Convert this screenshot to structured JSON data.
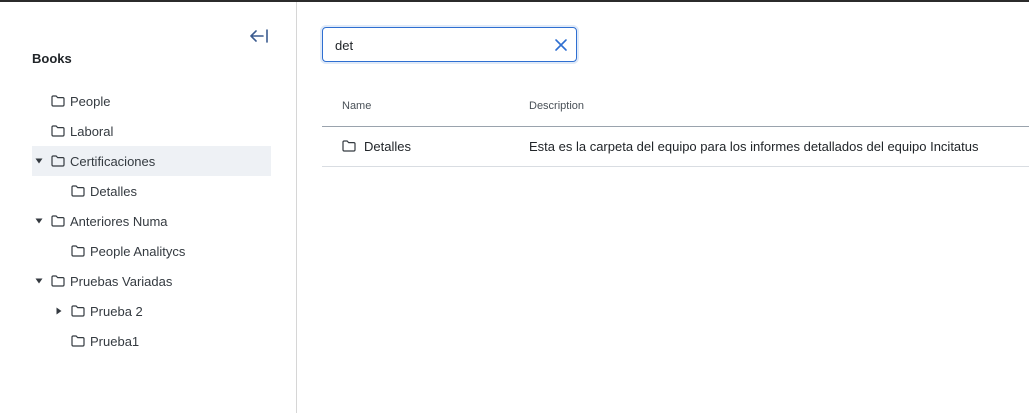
{
  "sidebar": {
    "title": "Books",
    "collapse_icon": "collapse-left-icon",
    "items": [
      {
        "label": "People",
        "caret": "none",
        "depth": 0,
        "selected": false
      },
      {
        "label": "Laboral",
        "caret": "none",
        "depth": 0,
        "selected": false
      },
      {
        "label": "Certificaciones",
        "caret": "down",
        "depth": 0,
        "selected": true
      },
      {
        "label": "Detalles",
        "caret": "none",
        "depth": 1,
        "selected": false
      },
      {
        "label": "Anteriores Numa",
        "caret": "down",
        "depth": 0,
        "selected": false
      },
      {
        "label": "People Analitycs",
        "caret": "none",
        "depth": 1,
        "selected": false
      },
      {
        "label": "Pruebas Variadas",
        "caret": "down",
        "depth": 0,
        "selected": false
      },
      {
        "label": "Prueba 2",
        "caret": "right",
        "depth": 1,
        "selected": false
      },
      {
        "label": "Prueba1",
        "caret": "none",
        "depth": 1,
        "selected": false
      }
    ]
  },
  "search": {
    "value": "det",
    "clear_icon": "close-icon"
  },
  "table": {
    "headers": {
      "name": "Name",
      "description": "Description"
    },
    "rows": [
      {
        "name": "Detalles",
        "description": "Esta es la carpeta del equipo para los informes detallados del equipo Incitatus"
      }
    ]
  },
  "colors": {
    "accent": "#2f6fd1",
    "selected_bg": "#eef1f5",
    "text": "#212529"
  }
}
